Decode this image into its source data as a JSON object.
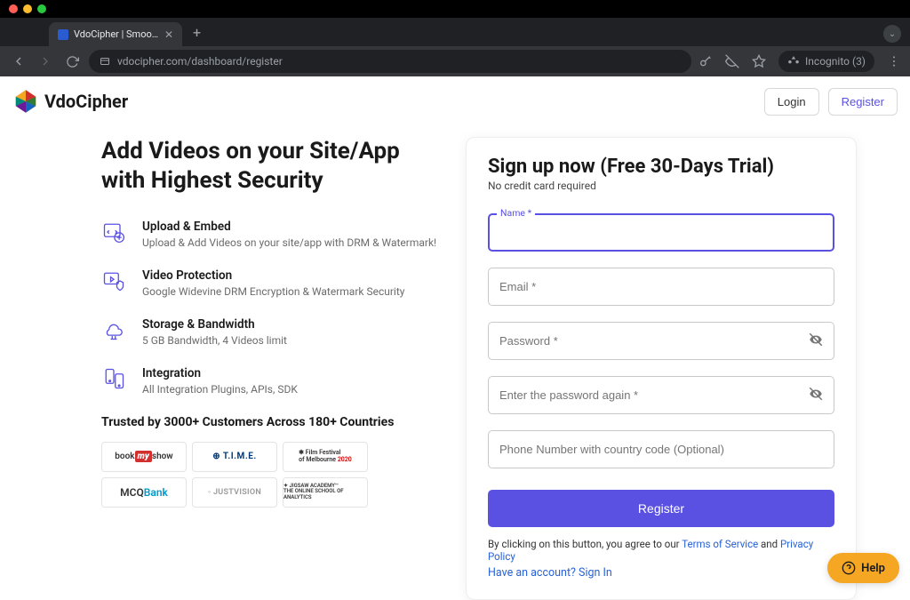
{
  "browser": {
    "tab_title": "VdoCipher | Smooth, secure s",
    "url": "vdocipher.com/dashboard/register",
    "incognito": "Incognito (3)"
  },
  "topbar": {
    "brand": "VdoCipher",
    "login": "Login",
    "register": "Register"
  },
  "left": {
    "heading": "Add Videos on your Site/App with Highest Security",
    "features": [
      {
        "title": "Upload & Embed",
        "desc": "Upload & Add Videos on your site/app with DRM & Watermark!"
      },
      {
        "title": "Video Protection",
        "desc": "Google Widevine DRM Encryption & Watermark Security"
      },
      {
        "title": "Storage & Bandwidth",
        "desc": "5 GB Bandwidth, 4 Videos limit"
      },
      {
        "title": "Integration",
        "desc": "All Integration Plugins, APIs, SDK"
      }
    ],
    "trusted": "Trusted by 3000+ Customers Across 180+ Countries",
    "customers": [
      "bookmyshow",
      "T.I.M.E.",
      "Film Festival of Melbourne 2020",
      "MCQBank",
      "JUSTVISION",
      "JIGSAW ACADEMY"
    ]
  },
  "form": {
    "title": "Sign up now (Free 30-Days Trial)",
    "subtitle": "No credit card required",
    "name_label": "Name *",
    "email_ph": "Email *",
    "password_ph": "Password *",
    "password2_ph": "Enter the password again *",
    "phone_ph": "Phone Number with country code (Optional)",
    "submit": "Register",
    "agree_prefix": "By clicking on this button, you agree to our ",
    "tos": "Terms of Service",
    "and": " and ",
    "privacy": "Privacy Policy",
    "have_account": "Have an account? Sign In"
  },
  "help": {
    "label": "Help"
  }
}
